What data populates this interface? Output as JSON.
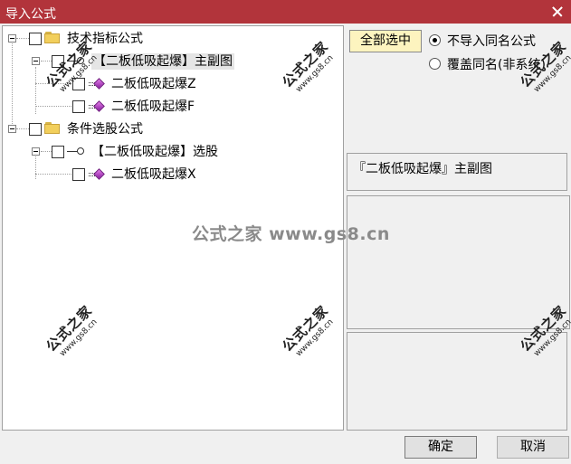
{
  "window": {
    "title": "导入公式"
  },
  "tree": {
    "groups": [
      {
        "label": "技术指标公式",
        "items": [
          {
            "label": "【二板低吸起爆】主副图",
            "icon": "key-icon",
            "highlighted": true
          },
          {
            "label": "二板低吸起爆Z",
            "icon": "gem-icon"
          },
          {
            "label": "二板低吸起爆F",
            "icon": "gem-icon"
          }
        ]
      },
      {
        "label": "条件选股公式",
        "items": [
          {
            "label": "【二板低吸起爆】选股",
            "icon": "key-icon"
          },
          {
            "label": "二板低吸起爆X",
            "icon": "gem-icon"
          }
        ]
      }
    ]
  },
  "controls": {
    "select_all": "全部选中",
    "radio_no_import": "不导入同名公式",
    "radio_overwrite": "覆盖同名(非系统)",
    "selected_radio": "no_import"
  },
  "description": "『二板低吸起爆』主副图",
  "buttons": {
    "ok": "确定",
    "cancel": "取消"
  },
  "watermark": {
    "text": "公式之家",
    "url": "www.gs8.cn",
    "center": "公式之家 www.gs8.cn"
  },
  "colors": {
    "titlebar": "#b2343b",
    "select_all_bg": "#fdf4bf",
    "gem": "#b23cc4"
  }
}
